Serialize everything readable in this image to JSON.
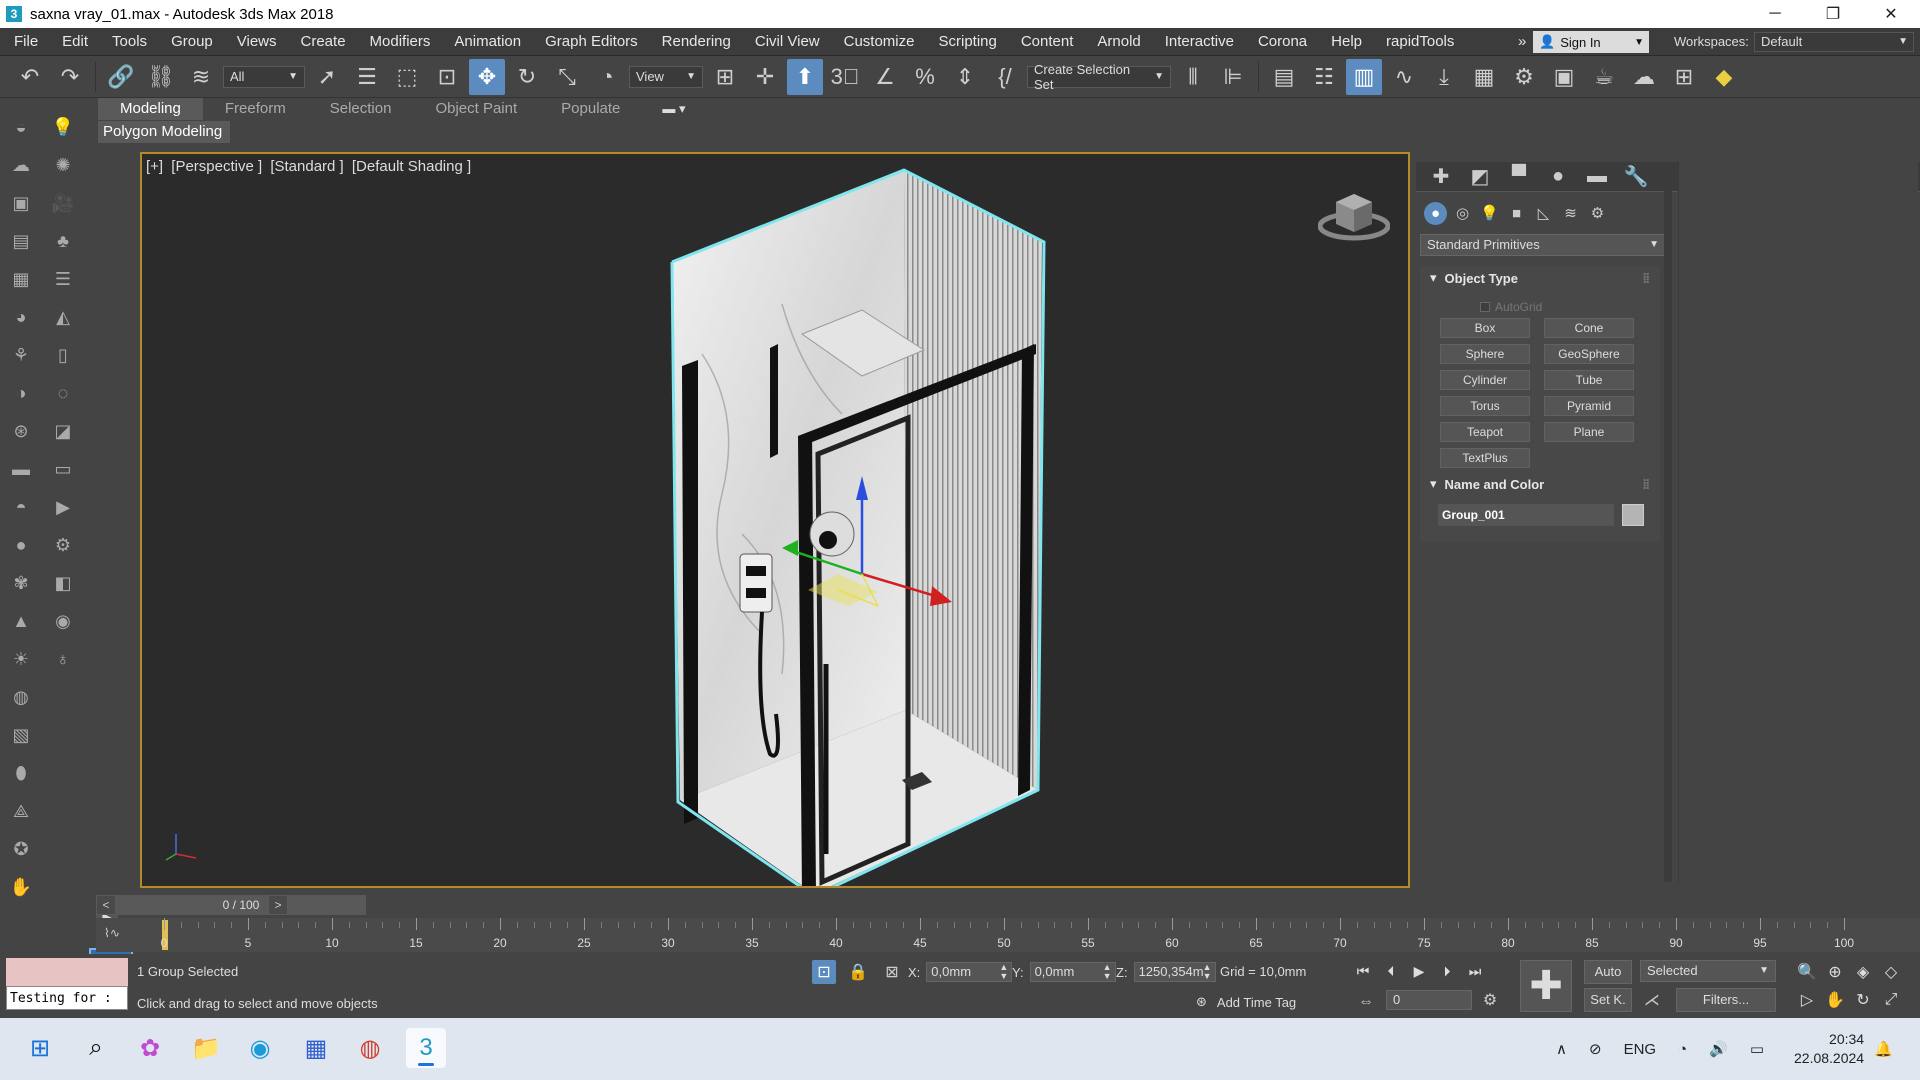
{
  "window": {
    "title": "saxna vray_01.max - Autodesk 3ds Max 2018",
    "minimize": "─",
    "maximize": "❐",
    "close": "✕"
  },
  "menu": {
    "items": [
      "File",
      "Edit",
      "Tools",
      "Group",
      "Views",
      "Create",
      "Modifiers",
      "Animation",
      "Graph Editors",
      "Rendering",
      "Civil View",
      "Customize",
      "Scripting",
      "Content",
      "Arnold",
      "Interactive",
      "Corona",
      "Help",
      "rapidTools"
    ],
    "overflow": "»",
    "sign_in": "Sign In",
    "workspaces_label": "Workspaces:",
    "workspace_value": "Default"
  },
  "toolbar": {
    "filter_value": "All",
    "refcoord_value": "View",
    "selection_set_placeholder": "Create Selection Set"
  },
  "ribbon": {
    "tabs": [
      "Modeling",
      "Freeform",
      "Selection",
      "Object Paint",
      "Populate"
    ],
    "active_tab": "Modeling",
    "panel_label": "Polygon Modeling"
  },
  "viewport": {
    "label_plus": "[+]",
    "label_view": "[Perspective ]",
    "label_style": "[Standard ]",
    "label_shading": "[Default Shading ]",
    "axis_z": "z",
    "axis_x": "x",
    "axis_y": "y"
  },
  "command_panel": {
    "category_dropdown": "Standard Primitives",
    "object_type_title": "Object Type",
    "autogrid_label": "AutoGrid",
    "primitives": [
      "Box",
      "Cone",
      "Sphere",
      "GeoSphere",
      "Cylinder",
      "Tube",
      "Torus",
      "Pyramid",
      "Teapot",
      "Plane",
      "TextPlus"
    ],
    "name_color_title": "Name and Color",
    "object_name": "Group_001"
  },
  "time_slider": {
    "value": "0 / 100",
    "prev": "<",
    "next": ">"
  },
  "trackbar": {
    "ticks": [
      0,
      5,
      10,
      15,
      20,
      25,
      30,
      35,
      40,
      45,
      50,
      55,
      60,
      65,
      70,
      75,
      80,
      85,
      90,
      95,
      100
    ]
  },
  "status": {
    "maxscript_text": "Testing for :",
    "selection_info": "1 Group Selected",
    "prompt": "Click and drag to select and move objects",
    "x_label": "X:",
    "x_value": "0,0mm",
    "y_label": "Y:",
    "y_value": "0,0mm",
    "z_label": "Z:",
    "z_value": "1250,354m",
    "grid": "Grid = 10,0mm",
    "add_time_tag": "Add Time Tag",
    "auto_key": "Auto",
    "set_key": "Set K.",
    "selected_dropdown": "Selected",
    "filters": "Filters...",
    "frame_value": "0"
  },
  "taskbar": {
    "language": "ENG",
    "time": "20:34",
    "date": "22.08.2024"
  }
}
